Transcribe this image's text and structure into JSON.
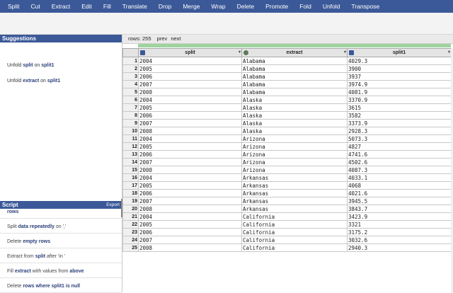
{
  "toolbar": {
    "items": [
      "Split",
      "Cut",
      "Extract",
      "Edit",
      "Fill",
      "Translate",
      "Drop",
      "Merge",
      "Wrap",
      "Delete",
      "Promote",
      "Fold",
      "Unfold",
      "Transpose"
    ]
  },
  "suggestions": {
    "title": "Suggestions",
    "items": [
      {
        "pre": "Unfold ",
        "b1": "split",
        "mid": " on ",
        "b2": "split1"
      },
      {
        "pre": "Unfold ",
        "b1": "extract",
        "mid": " on ",
        "b2": "split1"
      }
    ]
  },
  "script": {
    "title": "Script",
    "export_label": "Export",
    "items": [
      {
        "pre": "",
        "b1": "rows",
        "mid": "",
        "b2": "",
        "post": ""
      },
      {
        "pre": "Split ",
        "b1": "data repeatedly",
        "mid": " on ','",
        "b2": "",
        "post": ""
      },
      {
        "pre": "Delete ",
        "b1": "empty rows",
        "mid": "",
        "b2": "",
        "post": ""
      },
      {
        "pre": "Extract from ",
        "b1": "split",
        "mid": " after 'in '",
        "b2": "",
        "post": ""
      },
      {
        "pre": "Fill ",
        "b1": "extract",
        "mid": " with values from ",
        "b2": "above",
        "post": ""
      },
      {
        "pre": "Delete ",
        "b1": "rows where split1 is null",
        "mid": "",
        "b2": "",
        "post": ""
      }
    ]
  },
  "grid": {
    "rows_label": "rows: 255",
    "prev_label": "prev",
    "next_label": "next",
    "columns": [
      {
        "name": "split",
        "icon": "hash-icon"
      },
      {
        "name": "extract",
        "icon": "circle-icon"
      },
      {
        "name": "split1",
        "icon": "hash-icon"
      }
    ],
    "rows": [
      [
        "1",
        "2004",
        "Alabama",
        "4029.3"
      ],
      [
        "2",
        "2005",
        "Alabama",
        "3900"
      ],
      [
        "3",
        "2006",
        "Alabama",
        "3937"
      ],
      [
        "4",
        "2007",
        "Alabama",
        "3974.9"
      ],
      [
        "5",
        "2008",
        "Alabama",
        "4081.9"
      ],
      [
        "6",
        "2004",
        "Alaska",
        "3370.9"
      ],
      [
        "7",
        "2005",
        "Alaska",
        "3615"
      ],
      [
        "8",
        "2006",
        "Alaska",
        "3582"
      ],
      [
        "9",
        "2007",
        "Alaska",
        "3373.9"
      ],
      [
        "10",
        "2008",
        "Alaska",
        "2928.3"
      ],
      [
        "11",
        "2004",
        "Arizona",
        "5073.3"
      ],
      [
        "12",
        "2005",
        "Arizona",
        "4827"
      ],
      [
        "13",
        "2006",
        "Arizona",
        "4741.6"
      ],
      [
        "14",
        "2007",
        "Arizona",
        "4502.6"
      ],
      [
        "15",
        "2008",
        "Arizona",
        "4087.3"
      ],
      [
        "16",
        "2004",
        "Arkansas",
        "4033.1"
      ],
      [
        "17",
        "2005",
        "Arkansas",
        "4068"
      ],
      [
        "18",
        "2006",
        "Arkansas",
        "4021.6"
      ],
      [
        "19",
        "2007",
        "Arkansas",
        "3945.5"
      ],
      [
        "20",
        "2008",
        "Arkansas",
        "3843.7"
      ],
      [
        "21",
        "2004",
        "California",
        "3423.9"
      ],
      [
        "22",
        "2005",
        "California",
        "3321"
      ],
      [
        "23",
        "2006",
        "California",
        "3175.2"
      ],
      [
        "24",
        "2007",
        "California",
        "3032.6"
      ],
      [
        "25",
        "2008",
        "California",
        "2940.3"
      ]
    ]
  }
}
